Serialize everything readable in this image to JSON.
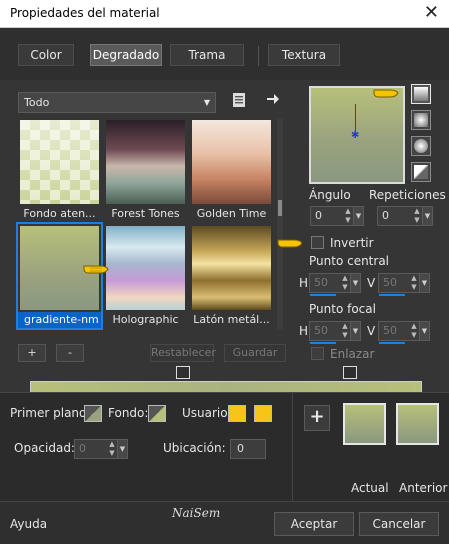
{
  "window": {
    "title": "Propiedades del material",
    "close_glyph": "✕"
  },
  "tabs": [
    {
      "label": "Color",
      "active": false
    },
    {
      "label": "Degradado",
      "active": true
    },
    {
      "label": "Trama",
      "active": false
    },
    {
      "label": "Textura",
      "active": false
    }
  ],
  "gradient_browser": {
    "filter_value": "Todo",
    "gradients": [
      {
        "label": "Fondo aten...",
        "selected": false
      },
      {
        "label": "Forest Tones",
        "selected": false
      },
      {
        "label": "Golden Time",
        "selected": false
      },
      {
        "label": "gradiente-nm",
        "selected": true
      },
      {
        "label": "Holographic",
        "selected": false
      },
      {
        "label": "Latón metál...",
        "selected": false
      }
    ],
    "add_label": "+",
    "remove_label": "-",
    "reset_label": "Restablecer",
    "save_label": "Guardar"
  },
  "settings": {
    "angle_label": "Ángulo",
    "angle_value": "0",
    "repeats_label": "Repeticiones",
    "repeats_value": "0",
    "invert_label": "Invertir",
    "center_label": "Punto central",
    "center_h_label": "H",
    "center_h_value": "50",
    "center_v_label": "V",
    "center_v_value": "50",
    "focal_label": "Punto focal",
    "focal_h_label": "H",
    "focal_h_value": "50",
    "focal_v_label": "V",
    "focal_v_value": "50",
    "link_label": "Enlazar"
  },
  "footer": {
    "foreground_label": "Primer plano:",
    "background_label": "Fondo:",
    "user_label": "Usuario:",
    "opacity_label": "Opacidad:",
    "opacity_value": "0",
    "location_label": "Ubicación:",
    "location_value": "0",
    "current_label": "Actual",
    "previous_label": "Anterior",
    "add_swatch_label": "+",
    "help_label": "Ayuda",
    "watermark": "NaiSem",
    "ok_label": "Aceptar",
    "cancel_label": "Cancelar"
  },
  "colors": {
    "gradient_top": "#b7c07a",
    "gradient_bottom": "#8a987f",
    "user_color": "#f5c518",
    "accent": "#1e7fe0"
  }
}
